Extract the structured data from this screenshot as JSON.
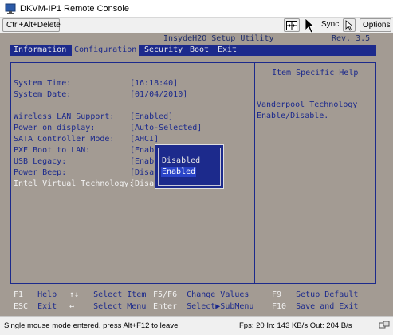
{
  "window": {
    "title": "DKVM-IP1 Remote Console"
  },
  "toolbar": {
    "ctrl_alt_delete": "Ctrl+Alt+Delete",
    "sync_label": "Sync",
    "options_label": "Options",
    "icons": [
      "keyboard-icon",
      "mouse-cursor-icon",
      "arrow-cursor-icon"
    ]
  },
  "bios": {
    "utility_name": "InsydeH2O Setup Utility",
    "revision": "Rev. 3.5",
    "menu": [
      {
        "label": "Information",
        "active": false
      },
      {
        "label": "Configuration",
        "active": true
      },
      {
        "label": "Security",
        "active": false
      },
      {
        "label": "Boot",
        "active": false
      },
      {
        "label": "Exit",
        "active": false
      }
    ],
    "settings": [
      {
        "label": "System Time:",
        "value": "[16:18:40]"
      },
      {
        "label": "System Date:",
        "value": "[01/04/2010]"
      },
      {
        "label": "Wireless LAN Support:",
        "value": "[Enabled]"
      },
      {
        "label": "Power on display:",
        "value": "[Auto-Selected]"
      },
      {
        "label": "SATA Controller Mode:",
        "value": "[AHCI]"
      },
      {
        "label": "PXE Boot to LAN:",
        "value": "[Enab"
      },
      {
        "label": "USB Legacy:",
        "value": "[Enab"
      },
      {
        "label": "Power Beep:",
        "value": "[Disa"
      },
      {
        "label": "Intel Virtual Technology:",
        "value": "[Disa"
      }
    ],
    "help": {
      "title": "Item Specific Help",
      "lines": [
        "Vanderpool Technology",
        "Enable/Disable."
      ]
    },
    "popup": {
      "options": [
        {
          "label": "Disabled",
          "selected": false
        },
        {
          "label": "Enabled",
          "selected": true
        }
      ]
    },
    "footer": [
      {
        "key": "F1",
        "desc": "Help"
      },
      {
        "key": "↑↓",
        "desc": "Select Item"
      },
      {
        "key": "F5/F6",
        "desc": "Change Values"
      },
      {
        "key": "F9",
        "desc": "Setup Default"
      },
      {
        "key": "ESC",
        "desc": "Exit"
      },
      {
        "key": "↔",
        "desc": "Select Menu"
      },
      {
        "key": "Enter",
        "desc": "Select▶SubMenu"
      },
      {
        "key": "F10",
        "desc": "Save and Exit"
      }
    ]
  },
  "status": {
    "message": "Single mouse mode entered, press Alt+F12 to leave",
    "stats": "Fps: 20 In: 143 KB/s Out: 204 B/s"
  },
  "colors": {
    "bios_background": "#a39b93",
    "bios_blue": "#1c2a8c",
    "highlight_text": "#f2f2f2"
  }
}
